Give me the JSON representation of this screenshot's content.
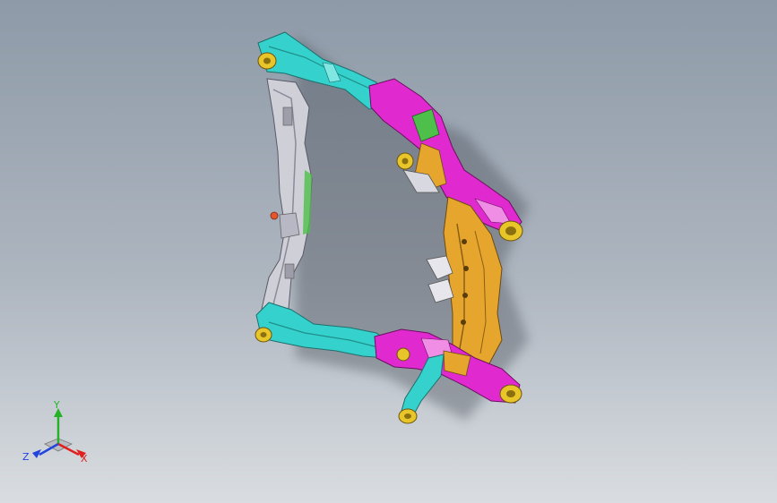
{
  "viewport": {
    "background_top": "#8e9aa8",
    "background_bottom": "#d9dde1",
    "model": {
      "part_colors": {
        "front_arms": "#35d1cc",
        "side_rail": "#c9c9d2",
        "brackets": "#e02ad0",
        "rear_crossmember": "#e6a62d",
        "mount_bushings": "#e8c528",
        "accent_green": "#4dbf4a",
        "accent_red": "#e4572e"
      }
    },
    "triad": {
      "x_label": "X",
      "y_label": "Y",
      "z_label": "Z",
      "x_color": "#e0201e",
      "y_color": "#26b226",
      "z_color": "#2244dd"
    }
  }
}
